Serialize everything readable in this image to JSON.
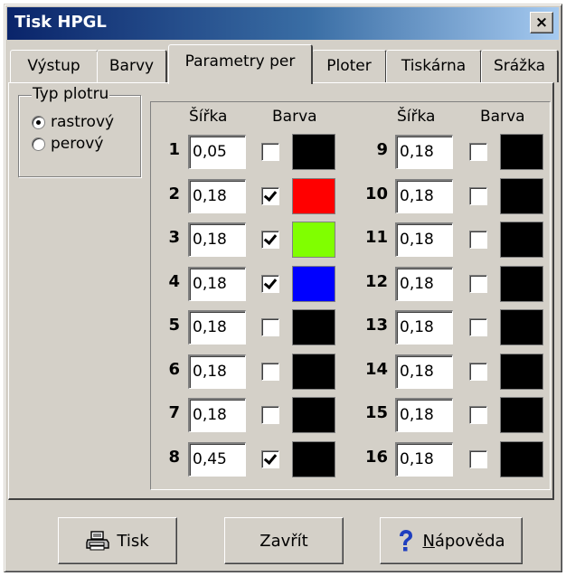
{
  "window": {
    "title": "Tisk HPGL",
    "close_glyph": "×"
  },
  "tabs": [
    {
      "label": "Výstup"
    },
    {
      "label": "Barvy"
    },
    {
      "label": "Parametry per",
      "active": true
    },
    {
      "label": "Ploter"
    },
    {
      "label": "Tiskárna"
    },
    {
      "label": "Srážka"
    }
  ],
  "plot_type": {
    "label": "Typ plotru",
    "options": [
      {
        "label": "rastrový",
        "selected": true
      },
      {
        "label": "perový",
        "selected": false
      }
    ]
  },
  "pen_headers": {
    "width": "Šířka",
    "color": "Barva"
  },
  "pens": [
    {
      "num": "1",
      "width": "0,05",
      "checked": false,
      "color": "#000000"
    },
    {
      "num": "2",
      "width": "0,18",
      "checked": true,
      "color": "#ff0000"
    },
    {
      "num": "3",
      "width": "0,18",
      "checked": true,
      "color": "#80ff00"
    },
    {
      "num": "4",
      "width": "0,18",
      "checked": true,
      "color": "#0000ff"
    },
    {
      "num": "5",
      "width": "0,18",
      "checked": false,
      "color": "#000000"
    },
    {
      "num": "6",
      "width": "0,18",
      "checked": false,
      "color": "#000000"
    },
    {
      "num": "7",
      "width": "0,18",
      "checked": false,
      "color": "#000000"
    },
    {
      "num": "8",
      "width": "0,45",
      "checked": true,
      "color": "#000000"
    },
    {
      "num": "9",
      "width": "0,18",
      "checked": false,
      "color": "#000000"
    },
    {
      "num": "10",
      "width": "0,18",
      "checked": false,
      "color": "#000000"
    },
    {
      "num": "11",
      "width": "0,18",
      "checked": false,
      "color": "#000000"
    },
    {
      "num": "12",
      "width": "0,18",
      "checked": false,
      "color": "#000000"
    },
    {
      "num": "13",
      "width": "0,18",
      "checked": false,
      "color": "#000000"
    },
    {
      "num": "14",
      "width": "0,18",
      "checked": false,
      "color": "#000000"
    },
    {
      "num": "15",
      "width": "0,18",
      "checked": false,
      "color": "#000000"
    },
    {
      "num": "16",
      "width": "0,18",
      "checked": false,
      "color": "#000000"
    }
  ],
  "buttons": {
    "print": {
      "label": "Tisk",
      "icon": "printer-icon"
    },
    "close": {
      "label": "Zavřít"
    },
    "help": {
      "label": "Nápověda",
      "icon": "question-icon"
    }
  }
}
